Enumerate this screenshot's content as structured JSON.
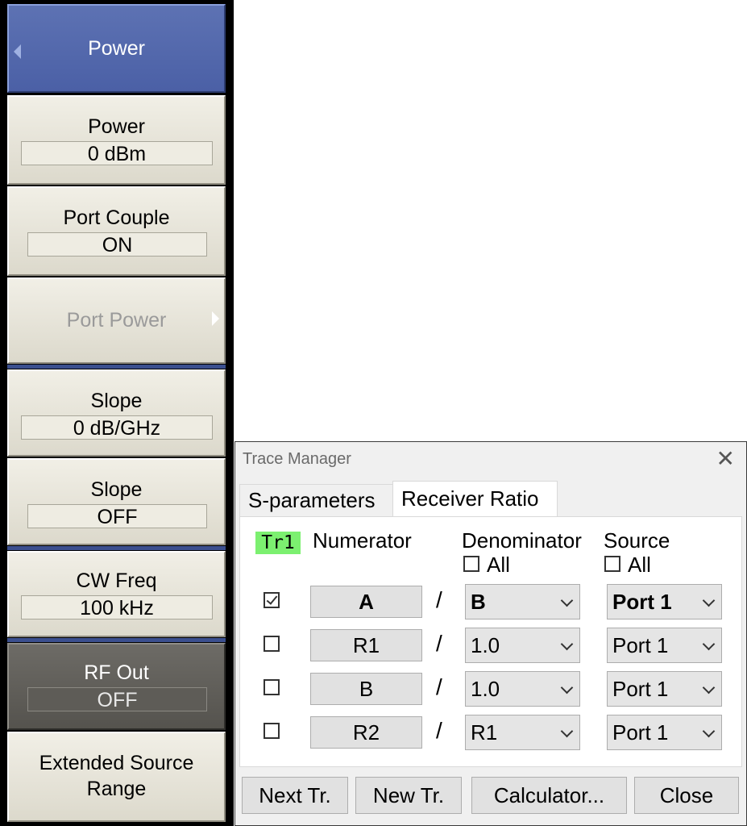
{
  "softkeys": {
    "header": "Power",
    "power": {
      "label": "Power",
      "value": "0 dBm"
    },
    "port_couple": {
      "label": "Port Couple",
      "value": "ON"
    },
    "port_power": {
      "label": "Port Power"
    },
    "slope1": {
      "label": "Slope",
      "value": "0 dB/GHz"
    },
    "slope2": {
      "label": "Slope",
      "value": "OFF"
    },
    "cw_freq": {
      "label": "CW Freq",
      "value": "100 kHz"
    },
    "rf_out": {
      "label": "RF Out",
      "value": "OFF"
    },
    "extended": {
      "line1": "Extended Source",
      "line2": "Range"
    }
  },
  "dialog": {
    "title": "Trace Manager",
    "close_glyph": "✕",
    "tabs": [
      "S-parameters",
      "Receiver Ratio"
    ],
    "active_tab": "Receiver Ratio",
    "trace_badge": "Tr1",
    "headers": {
      "numerator": "Numerator",
      "denominator": "Denominator",
      "source": "Source",
      "all": "All"
    },
    "rows": [
      {
        "checked": true,
        "numerator": "A",
        "denominator": "B",
        "source": "Port 1",
        "bold": true
      },
      {
        "checked": false,
        "numerator": "R1",
        "denominator": "1.0",
        "source": "Port 1",
        "bold": false
      },
      {
        "checked": false,
        "numerator": "B",
        "denominator": "1.0",
        "source": "Port 1",
        "bold": false
      },
      {
        "checked": false,
        "numerator": "R2",
        "denominator": "R1",
        "source": "Port 1",
        "bold": false
      }
    ],
    "slash": "/",
    "buttons": {
      "next": "Next Tr.",
      "new": "New Tr.",
      "calculator": "Calculator...",
      "close": "Close"
    }
  },
  "colors": {
    "header_blue": "#4b60a6",
    "badge_green": "#7cf070",
    "disabled_text": "#9a9a9a"
  }
}
